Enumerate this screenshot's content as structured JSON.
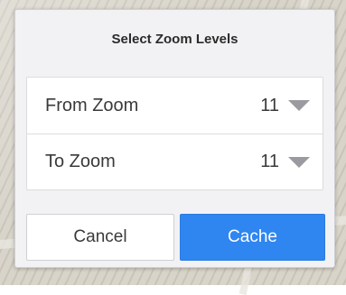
{
  "dialog": {
    "title": "Select Zoom Levels",
    "rows": [
      {
        "label": "From Zoom",
        "value": "11",
        "icon": "dropdown-caret-icon"
      },
      {
        "label": "To Zoom",
        "value": "11",
        "icon": "dropdown-caret-icon"
      }
    ],
    "buttons": {
      "cancel_label": "Cancel",
      "cache_label": "Cache"
    }
  },
  "colors": {
    "primary_button": "#2f86f0",
    "dialog_background": "#f2f2f4"
  }
}
